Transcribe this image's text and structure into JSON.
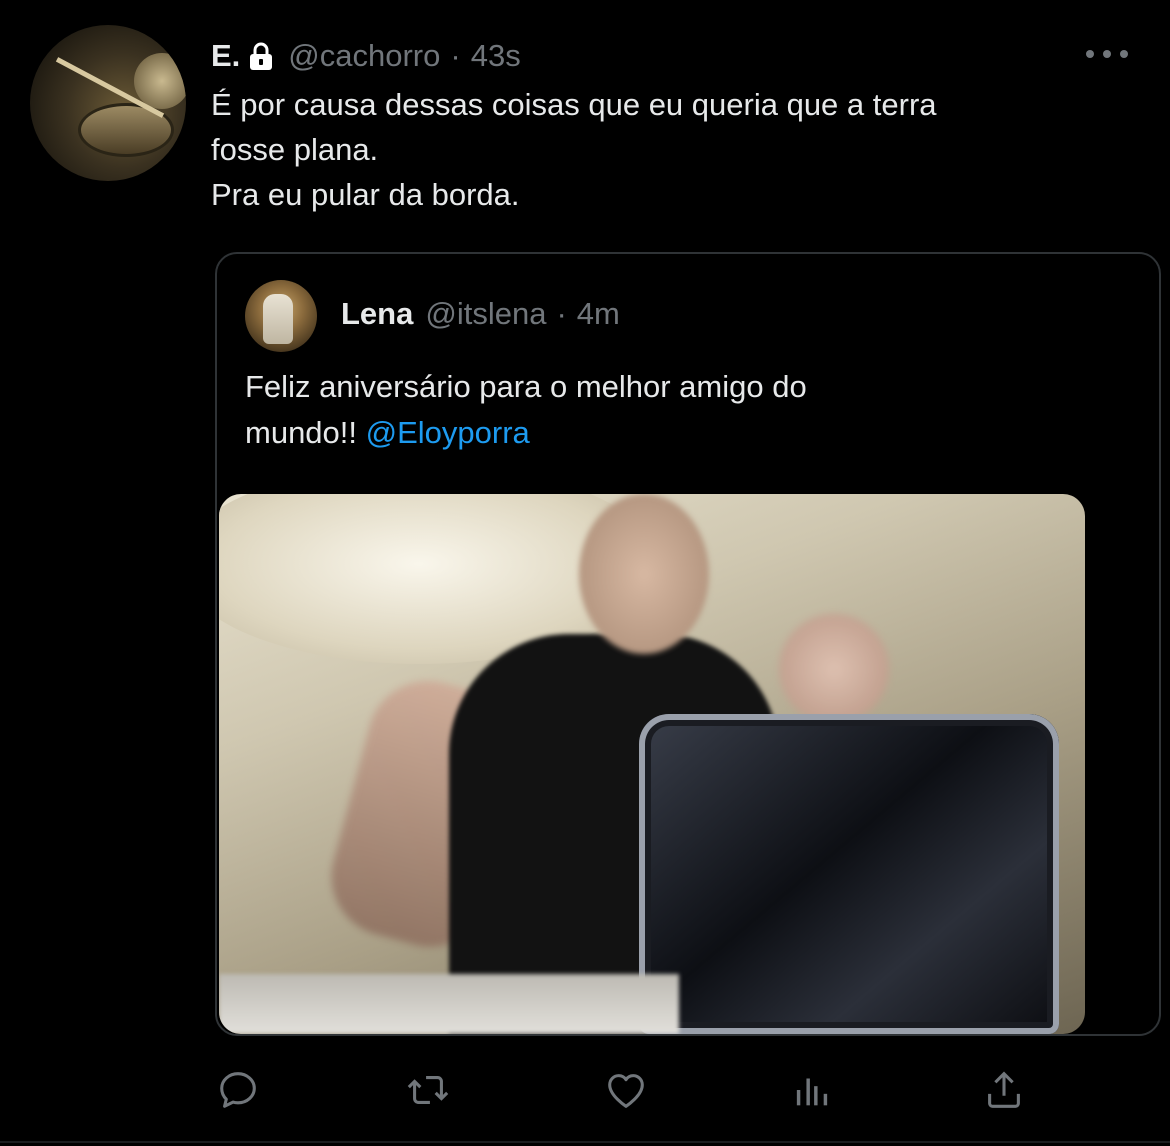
{
  "tweet": {
    "author": {
      "name": "E.",
      "protected_icon": "lock-icon",
      "handle": "@cachorro",
      "separator": "·",
      "time": "43s",
      "avatar_icon": "drum-kit-avatar"
    },
    "more_icon": "more-horizontal-icon",
    "text_lines": [
      "É por causa dessas coisas que eu queria que a terra",
      "fosse plana.",
      "Pra eu pular da borda."
    ]
  },
  "quoted_tweet": {
    "author": {
      "name": "Lena",
      "handle": "@itslena",
      "separator": "·",
      "time": "4m",
      "avatar_icon": "user-avatar"
    },
    "text_line1": "Feliz aniversário para o melhor amigo do",
    "text_line2_prefix": "mundo!! ",
    "mention": "@Eloyporra",
    "media_icon": "blurry-drummer-photo"
  },
  "actions": [
    {
      "name": "reply",
      "icon": "reply-icon"
    },
    {
      "name": "retweet",
      "icon": "retweet-icon"
    },
    {
      "name": "like",
      "icon": "heart-icon"
    },
    {
      "name": "analytics",
      "icon": "analytics-icon"
    },
    {
      "name": "share",
      "icon": "share-icon"
    }
  ],
  "colors": {
    "background": "#000000",
    "text_primary": "#e7e9ea",
    "text_secondary": "#71767b",
    "link": "#1d9bf0",
    "border": "#2f3336"
  }
}
